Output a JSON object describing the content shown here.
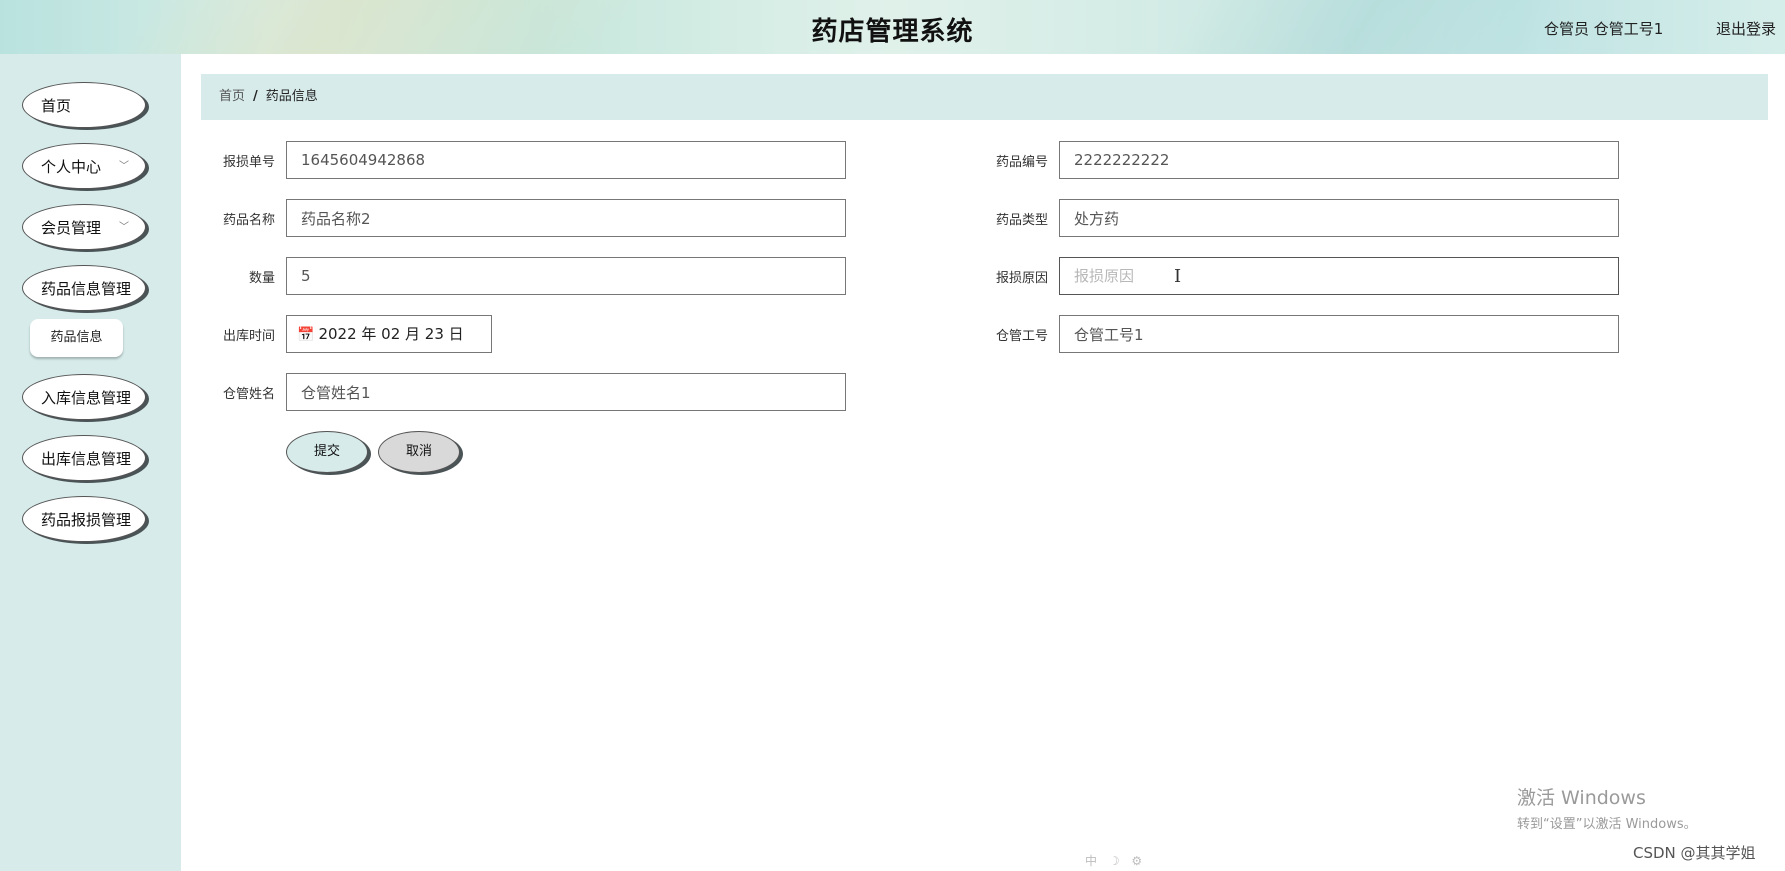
{
  "header": {
    "title": "药店管理系统",
    "user_info": "仓管员 仓管工号1",
    "logout_label": "退出登录"
  },
  "sidebar": {
    "items": [
      {
        "label": "首页",
        "has_chevron": false
      },
      {
        "label": "个人中心",
        "has_chevron": true
      },
      {
        "label": "会员管理",
        "has_chevron": true
      },
      {
        "label": "药品信息管理",
        "has_chevron": false
      },
      {
        "label": "入库信息管理",
        "has_chevron": false
      },
      {
        "label": "出库信息管理",
        "has_chevron": false
      },
      {
        "label": "药品报损管理",
        "has_chevron": false
      }
    ],
    "submenu": {
      "label": "药品信息"
    },
    "chevron_glyph": "﹀"
  },
  "breadcrumb": {
    "home": "首页",
    "separator": "/",
    "current": "药品信息"
  },
  "form": {
    "report_no": {
      "label": "报损单号",
      "value": "1645604942868"
    },
    "drug_code": {
      "label": "药品编号",
      "value": "2222222222"
    },
    "drug_name": {
      "label": "药品名称",
      "value": "药品名称2"
    },
    "drug_type": {
      "label": "药品类型",
      "value": "处方药"
    },
    "quantity": {
      "label": "数量",
      "value": "5"
    },
    "reason": {
      "label": "报损原因",
      "value": "",
      "placeholder": "报损原因"
    },
    "out_time": {
      "label": "出库时间",
      "value": "2022 年 02 月 23 日"
    },
    "keeper_no": {
      "label": "仓管工号",
      "value": "仓管工号1"
    },
    "keeper_name": {
      "label": "仓管姓名",
      "value": "仓管姓名1"
    },
    "submit_label": "提交",
    "cancel_label": "取消"
  },
  "overlay": {
    "activate_title": "激活 Windows",
    "activate_sub": "转到“设置”以激活 Windows。",
    "watermark": "CSDN @其其学姐",
    "tray_hint": "中 ☽ ⚙"
  },
  "icons": {
    "calendar": "calendar-icon",
    "chevron": "chevron-down-icon",
    "text_cursor": "text-cursor-icon"
  }
}
